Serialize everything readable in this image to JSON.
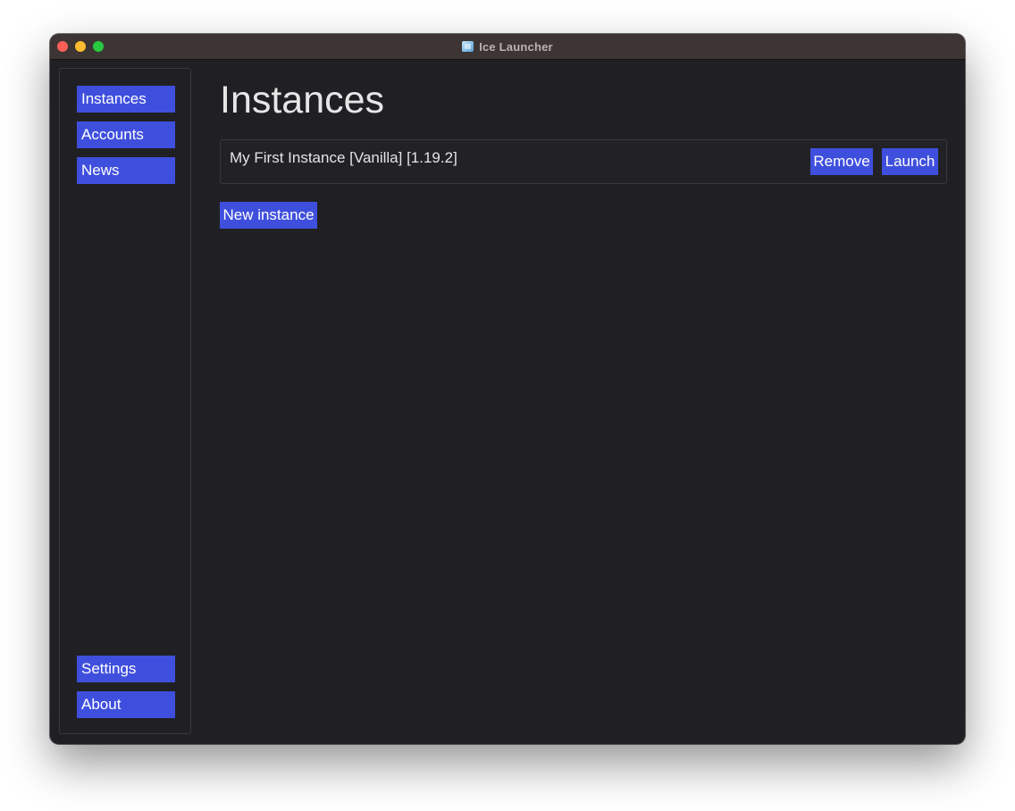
{
  "window": {
    "title": "Ice Launcher",
    "app_icon": "ice-cube-icon"
  },
  "sidebar": {
    "top_items": [
      {
        "label": "Instances"
      },
      {
        "label": "Accounts"
      },
      {
        "label": "News"
      }
    ],
    "bottom_items": [
      {
        "label": "Settings"
      },
      {
        "label": "About"
      }
    ]
  },
  "main": {
    "title": "Instances",
    "instances": [
      {
        "name": "My First Instance [Vanilla] [1.19.2]",
        "remove_label": "Remove",
        "launch_label": "Launch"
      }
    ],
    "new_instance_label": "New instance"
  },
  "colors": {
    "accent": "#3f4fdd",
    "background": "#202024",
    "titlebar": "#3c3534"
  }
}
